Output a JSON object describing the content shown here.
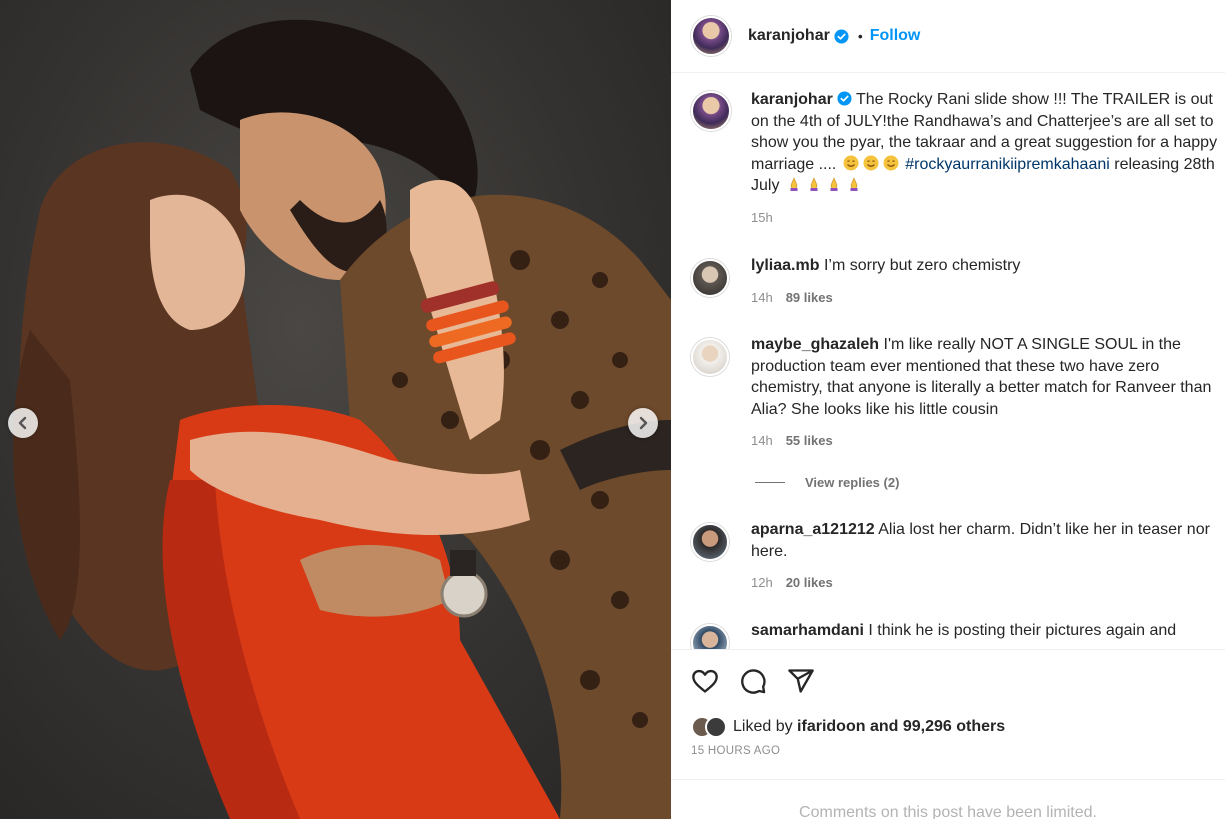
{
  "post": {
    "author": "karanjohar",
    "follow_label": "Follow",
    "separator": "•",
    "caption": {
      "text_before_hashtag": "The Rocky Rani slide show !!! The TRAILER is out on the 4th of JULY!the Randhawa’s and Chatterjee’s are all set to show you the pyar, the takraar and a great suggestion for a happy marriage ....",
      "hashtag": "#rockyaurranikiipremkahaani",
      "text_after_hashtag": "releasing 28th July",
      "time": "15h"
    },
    "likes_prefix": "Liked by",
    "liked_by_user": "ifaridoon",
    "likes_suffix": "and 99,296 others",
    "timestamp": "15 HOURS AGO",
    "comments_limited": "Comments on this post have been limited."
  },
  "comments": [
    {
      "user": "lyliaa.mb",
      "text": "I’m sorry but zero chemistry",
      "time": "14h",
      "likes": "89 likes"
    },
    {
      "user": "maybe_ghazaleh",
      "text": "I'm like really NOT A SINGLE SOUL in the production team ever mentioned that these two have zero chemistry, that anyone is literally a better match for Ranveer than Alia? She looks like his little cousin",
      "time": "14h",
      "likes": "55 likes",
      "view_replies": "View replies (2)"
    },
    {
      "user": "aparna_a121212",
      "text": "Alia lost her charm. Didn’t like her in teaser nor here.",
      "time": "12h",
      "likes": "20 likes"
    },
    {
      "user": "samarhamdani",
      "text": "I think he is posting their pictures again and"
    }
  ],
  "icons": {
    "prev": "chevron-left-icon",
    "next": "chevron-right-icon",
    "like": "heart-icon",
    "comment": "comment-icon",
    "share": "share-icon",
    "verified": "verified-badge-icon"
  },
  "colors": {
    "link_blue": "#0095f6",
    "verified_blue": "#0095f6",
    "hashtag": "#00376b",
    "muted": "#8e8e8e"
  }
}
